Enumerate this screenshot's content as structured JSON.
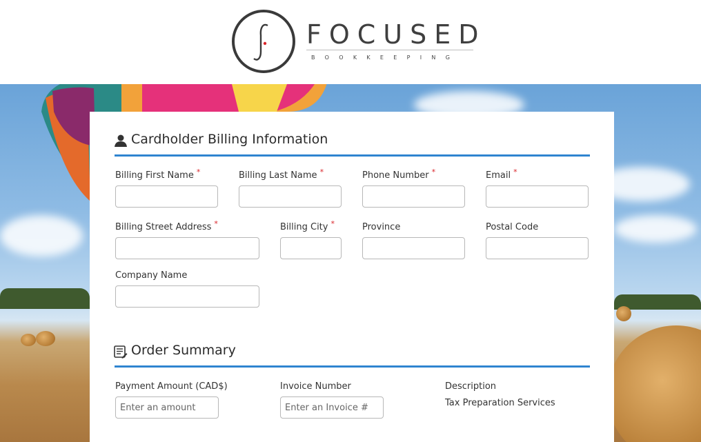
{
  "brand": {
    "logo_letter": "f",
    "name": "FOCUSED",
    "tagline": "BOOKKEEPING",
    "accent": "#2f84d0",
    "dot_color": "#d9262b"
  },
  "billing": {
    "title": "Cardholder Billing Information",
    "icon": "person-icon",
    "required_mark": "*",
    "fields": {
      "first_name": {
        "label": "Billing First Name",
        "value": ""
      },
      "last_name": {
        "label": "Billing Last Name",
        "value": ""
      },
      "phone": {
        "label": "Phone Number",
        "value": ""
      },
      "email": {
        "label": "Email",
        "value": ""
      },
      "street": {
        "label": "Billing Street Address",
        "value": ""
      },
      "city": {
        "label": "Billing City",
        "value": ""
      },
      "province": {
        "label": "Province",
        "value": ""
      },
      "postal": {
        "label": "Postal Code",
        "value": ""
      },
      "company": {
        "label": "Company Name",
        "value": ""
      }
    }
  },
  "order": {
    "title": "Order Summary",
    "icon": "order-list-icon",
    "payment": {
      "label": "Payment Amount (CAD$)",
      "placeholder": "Enter an amount"
    },
    "invoice": {
      "label": "Invoice Number",
      "placeholder": "Enter an Invoice #"
    },
    "description": {
      "label": "Description",
      "value": "Tax Preparation Services"
    }
  }
}
